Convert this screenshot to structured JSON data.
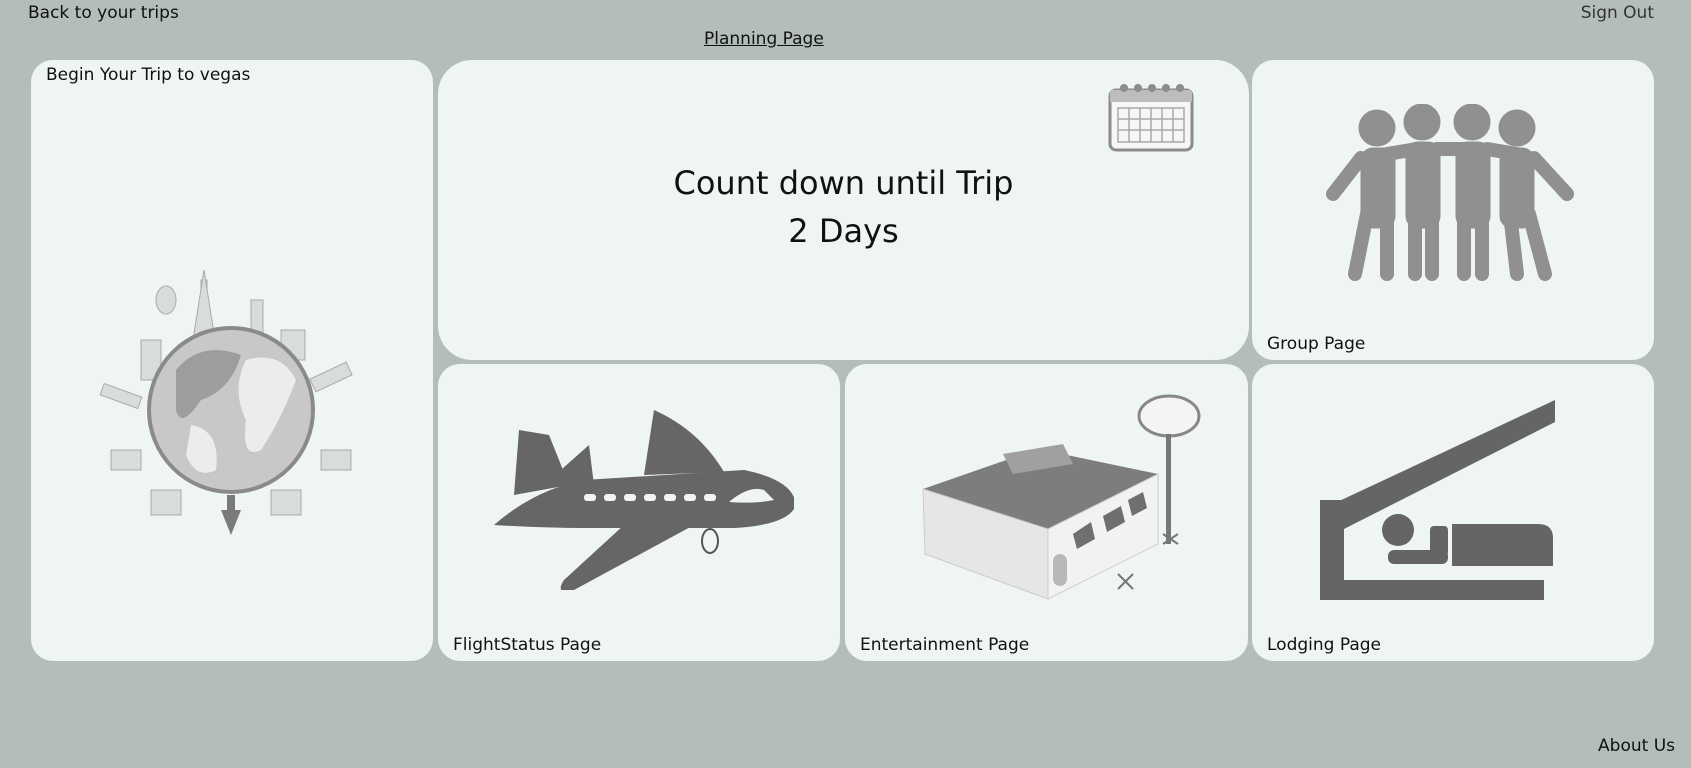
{
  "nav": {
    "back_label": "Back to your trips",
    "sign_out_label": "Sign Out",
    "page_title": "Planning Page",
    "about_label": "About Us"
  },
  "begin_card": {
    "title": "Begin Your Trip to vegas",
    "icon": "globe-landmarks-icon"
  },
  "countdown": {
    "title": "Count down until Trip",
    "days": "2 Days",
    "icon": "calendar-icon"
  },
  "tiles": {
    "group": {
      "label": "Group Page",
      "icon": "group-people-icon"
    },
    "flight": {
      "label": "FlightStatus Page",
      "icon": "airplane-icon"
    },
    "entertainment": {
      "label": "Entertainment Page",
      "icon": "restaurant-building-icon"
    },
    "lodging": {
      "label": "Lodging Page",
      "icon": "bed-shelter-icon"
    }
  },
  "colors": {
    "background": "#b4beb8",
    "card": "#eff5f2",
    "icon_gray": "#6b6b6b"
  }
}
